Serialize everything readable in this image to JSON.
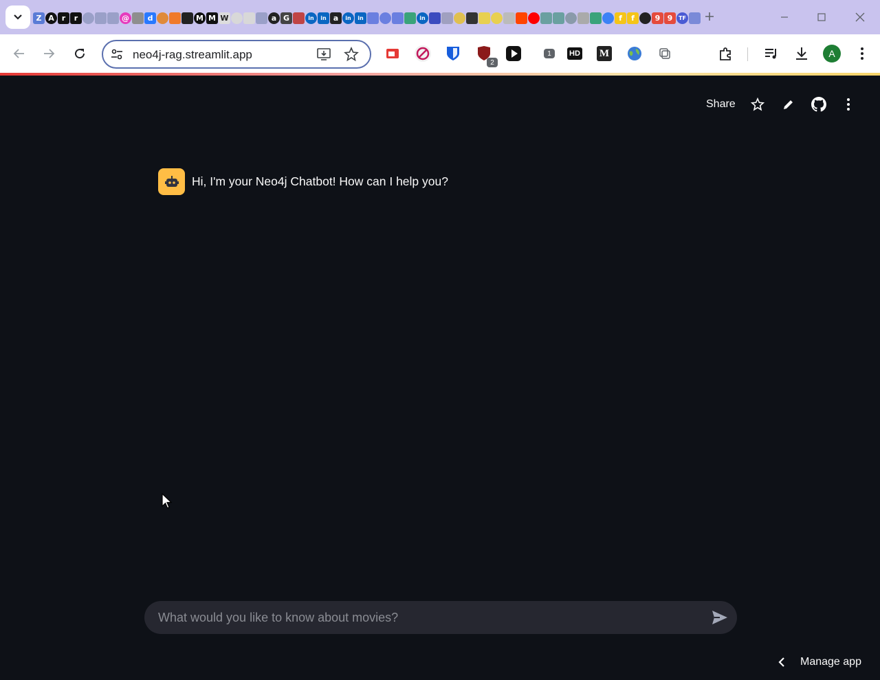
{
  "browser": {
    "tabs_pinned": [
      {
        "icon": "zotero-icon",
        "color": "#5a7cd6",
        "glyph": "Z"
      },
      {
        "icon": "a-icon",
        "color": "#111111",
        "glyph": "A"
      },
      {
        "icon": "r-icon",
        "color": "#111111",
        "glyph": "r"
      },
      {
        "icon": "r2-icon",
        "color": "#111111",
        "glyph": "r"
      },
      {
        "icon": "tab-icon-5",
        "color": "#9aa0c8",
        "glyph": ""
      },
      {
        "icon": "tab-icon-6",
        "color": "#9aa0c8",
        "glyph": ""
      },
      {
        "icon": "tab-icon-7",
        "color": "#9aa0c8",
        "glyph": ""
      },
      {
        "icon": "tab-icon-8",
        "color": "#e63bbd",
        "glyph": "@"
      },
      {
        "icon": "tab-icon-9",
        "color": "#8e8e8e",
        "glyph": ""
      },
      {
        "icon": "tab-icon-10",
        "color": "#2979ff",
        "glyph": "d"
      },
      {
        "icon": "tab-icon-11",
        "color": "#e08a3a",
        "glyph": ""
      },
      {
        "icon": "tab-icon-12",
        "color": "#f07a2a",
        "glyph": ""
      },
      {
        "icon": "openai-icon",
        "color": "#222222",
        "glyph": ""
      },
      {
        "icon": "medium-icon",
        "color": "#111111",
        "glyph": "M"
      },
      {
        "icon": "medium2-icon",
        "color": "#111111",
        "glyph": "M"
      },
      {
        "icon": "wikipedia-icon",
        "color": "#dddddd",
        "glyph": "W"
      },
      {
        "icon": "tab-icon-17",
        "color": "#d8d8d8",
        "glyph": ""
      },
      {
        "icon": "tab-icon-18",
        "color": "#d8d8d8",
        "glyph": ""
      },
      {
        "icon": "tab-icon-19",
        "color": "#9aa0c8",
        "glyph": ""
      },
      {
        "icon": "amazon-icon",
        "color": "#222222",
        "glyph": "a"
      },
      {
        "icon": "google-icon",
        "color": "#444444",
        "glyph": "G"
      },
      {
        "icon": "tab-icon-22",
        "color": "#c04444",
        "glyph": ""
      },
      {
        "icon": "linkedin-icon",
        "color": "#0a66c2",
        "glyph": "in"
      },
      {
        "icon": "linkedin2-icon",
        "color": "#0a66c2",
        "glyph": "in"
      },
      {
        "icon": "amazon2-icon",
        "color": "#222222",
        "glyph": "a"
      },
      {
        "icon": "linkedin3-icon",
        "color": "#0a66c2",
        "glyph": "in"
      },
      {
        "icon": "linkedin4-icon",
        "color": "#0a66c2",
        "glyph": "in"
      },
      {
        "icon": "tab-icon-28",
        "color": "#6a7fe0",
        "glyph": ""
      },
      {
        "icon": "tab-icon-29",
        "color": "#6a7fe0",
        "glyph": ""
      },
      {
        "icon": "tab-icon-30",
        "color": "#6a7fe0",
        "glyph": ""
      },
      {
        "icon": "tab-icon-31",
        "color": "#3aa37a",
        "glyph": ""
      },
      {
        "icon": "linkedin5-icon",
        "color": "#0a66c2",
        "glyph": "in"
      },
      {
        "icon": "list-icon",
        "color": "#3b4bbf",
        "glyph": ""
      },
      {
        "icon": "tab-icon-34",
        "color": "#a0a0c0",
        "glyph": ""
      },
      {
        "icon": "tab-icon-35",
        "color": "#e0c050",
        "glyph": ""
      },
      {
        "icon": "tab-icon-36",
        "color": "#333333",
        "glyph": ""
      },
      {
        "icon": "tab-icon-37",
        "color": "#e8d050",
        "glyph": ""
      },
      {
        "icon": "tab-icon-38",
        "color": "#e8d050",
        "glyph": ""
      },
      {
        "icon": "tab-icon-39",
        "color": "#bbbbbb",
        "glyph": ""
      },
      {
        "icon": "reddit-icon",
        "color": "#ff4500",
        "glyph": ""
      },
      {
        "icon": "youtube-icon",
        "color": "#ff0000",
        "glyph": ""
      },
      {
        "icon": "tab-icon-42",
        "color": "#6aa0a0",
        "glyph": ""
      },
      {
        "icon": "tab-icon-43",
        "color": "#6aa0a0",
        "glyph": ""
      },
      {
        "icon": "tab-icon-44",
        "color": "#8a9aaa",
        "glyph": ""
      },
      {
        "icon": "tab-icon-45",
        "color": "#aaaaaa",
        "glyph": ""
      },
      {
        "icon": "tab-icon-46",
        "color": "#3aa37a",
        "glyph": ""
      },
      {
        "icon": "tab-icon-47",
        "color": "#3b82f6",
        "glyph": ""
      },
      {
        "icon": "flipkart-icon",
        "color": "#f5c518",
        "glyph": "f"
      },
      {
        "icon": "flipkart2-icon",
        "color": "#f5c518",
        "glyph": "f"
      },
      {
        "icon": "tab-icon-50",
        "color": "#222222",
        "glyph": ""
      },
      {
        "icon": "tab-icon-51",
        "color": "#e54b3c",
        "glyph": "9"
      },
      {
        "icon": "tab-icon-52",
        "color": "#e54b3c",
        "glyph": "9"
      },
      {
        "icon": "tab-icon-53",
        "color": "#4a5bd4",
        "glyph": "TF"
      },
      {
        "icon": "tab-icon-54",
        "color": "#7a8ad8",
        "glyph": ""
      }
    ],
    "url": "neo4j-rag.streamlit.app",
    "profile_initial": "A",
    "ext_badge_1": "2",
    "ext_badge_2": "1",
    "ext_hd_label": "HD",
    "ext_m_label": "M"
  },
  "app": {
    "header": {
      "share_label": "Share"
    },
    "messages": [
      {
        "role": "assistant",
        "text": "Hi, I'm your Neo4j Chatbot! How can I help you?"
      }
    ],
    "chat_input": {
      "placeholder": "What would you like to know about movies?",
      "value": ""
    },
    "manage_app_label": "Manage app",
    "colors": {
      "background": "#0e1117",
      "input_bg": "#262730",
      "bot_avatar": "#ffbd45",
      "text": "#fafafa"
    }
  }
}
